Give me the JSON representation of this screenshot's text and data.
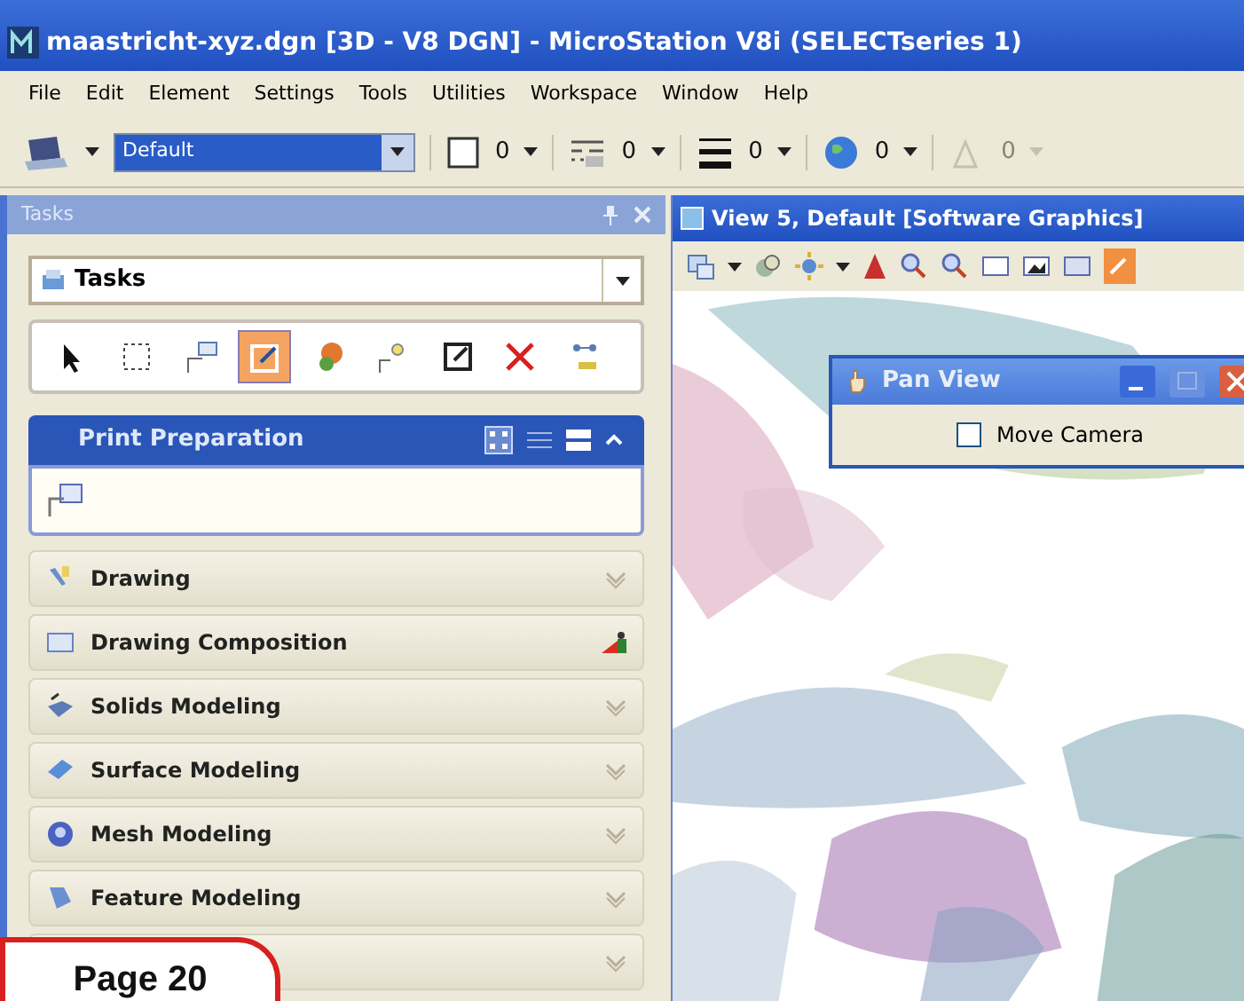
{
  "window": {
    "title": "maastricht-xyz.dgn [3D - V8 DGN] - MicroStation V8i (SELECTseries 1)"
  },
  "menu": [
    "File",
    "Edit",
    "Element",
    "Settings",
    "Tools",
    "Utilities",
    "Workspace",
    "Window",
    "Help"
  ],
  "attributes_toolbar": {
    "level": "Default",
    "pickers": [
      {
        "kind": "color",
        "value": "0",
        "disabled": false
      },
      {
        "kind": "style",
        "value": "0",
        "disabled": false
      },
      {
        "kind": "weight",
        "value": "0",
        "disabled": false
      },
      {
        "kind": "class",
        "value": "0",
        "disabled": false
      },
      {
        "kind": "transparency",
        "value": "0",
        "disabled": true
      }
    ]
  },
  "tasks_panel": {
    "title": "Tasks",
    "dropdown": "Tasks",
    "tools": [
      {
        "selected": false
      },
      {
        "selected": false
      },
      {
        "selected": false
      },
      {
        "selected": true
      },
      {
        "selected": false
      },
      {
        "selected": false
      },
      {
        "selected": false
      },
      {
        "selected": false
      },
      {
        "selected": false
      }
    ],
    "section": {
      "title": "Print Preparation",
      "expanded": true
    },
    "groups": [
      {
        "label": "Drawing",
        "kind": "group"
      },
      {
        "label": "Drawing Composition",
        "kind": "composition"
      },
      {
        "label": "Solids Modeling",
        "kind": "group"
      },
      {
        "label": "Surface Modeling",
        "kind": "group"
      },
      {
        "label": "Mesh Modeling",
        "kind": "group"
      },
      {
        "label": "Feature Modeling",
        "kind": "group"
      },
      {
        "kind": "group"
      }
    ]
  },
  "view": {
    "title": "View 5, Default [Software Graphics]"
  },
  "pan_view": {
    "title": "Pan View",
    "checkbox": {
      "label": "Move Camera",
      "checked": false
    }
  },
  "page_badge": "Page 20"
}
